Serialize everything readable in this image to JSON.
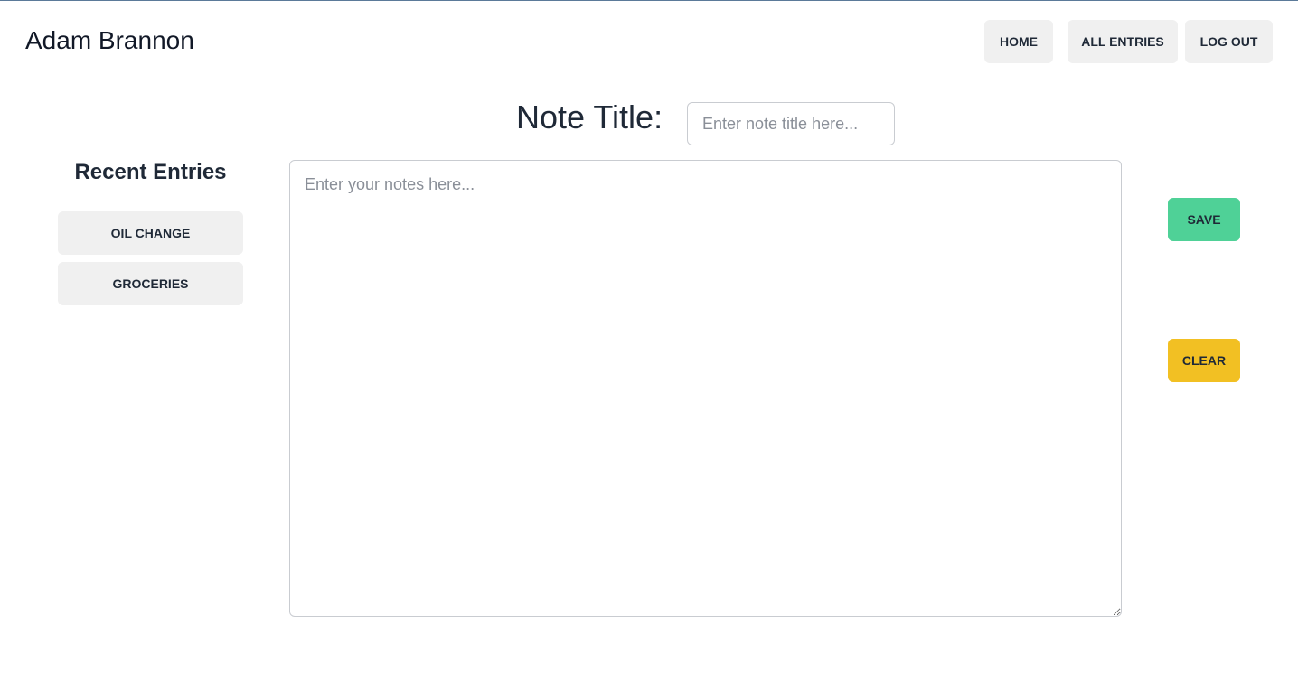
{
  "header": {
    "user_name": "Adam Brannon",
    "nav": {
      "home": "HOME",
      "all_entries": "ALL ENTRIES",
      "log_out": "LOG OUT"
    }
  },
  "editor": {
    "title_label": "Note Title:",
    "title_value": "",
    "title_placeholder": "Enter note title here...",
    "notes_value": "",
    "notes_placeholder": "Enter your notes here..."
  },
  "sidebar": {
    "heading": "Recent Entries",
    "entries": [
      {
        "label": "OIL CHANGE"
      },
      {
        "label": "GROCERIES"
      }
    ]
  },
  "actions": {
    "save_label": "SAVE",
    "clear_label": "CLEAR"
  },
  "colors": {
    "save": "#4fd197",
    "clear": "#f2c023",
    "nav_button": "#f0f0f0"
  }
}
